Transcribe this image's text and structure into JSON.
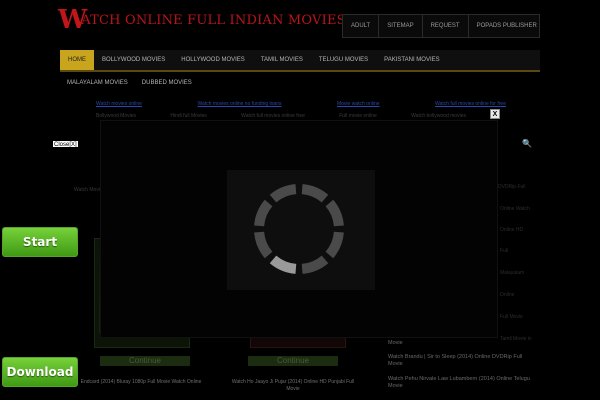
{
  "header": {
    "logo_letter": "W",
    "logo_text": "ATCH ONLINE FULL INDIAN MOVIES FREE",
    "top_links": [
      "ADULT",
      "SITEMAP",
      "REQUEST",
      "POPADS PUBLISHER"
    ]
  },
  "nav": {
    "items": [
      "HOME",
      "BOLLYWOOD MOVIES",
      "HOLLYWOOD MOVIES",
      "TAMIL MOVIES",
      "TELUGU MOVIES",
      "PAKISTANI MOVIES"
    ],
    "items2": [
      "MALAYALAM MOVIES",
      "DUBBED MOVIES"
    ]
  },
  "link_row": [
    "Watch movies online",
    "Watch movies online no funding loans",
    "Movie watch online",
    "Watch full movies online for free"
  ],
  "link_row2": [
    "Bollywood Movies",
    "Hindi full Movies",
    "Watch full movies online free",
    "Full movie online",
    "Watch bollywood movies"
  ],
  "background": {
    "heading": "Watch Movies Online",
    "side_items": [
      "DVDRip Full",
      "Online Watch",
      "Online HD",
      "Full",
      "Malayalam",
      "Online",
      "Full Movie",
      "Tamil Movie in"
    ],
    "side_bright": [
      "Movie",
      "Watch Brandu | Sir to Sleep (2014) Online DVDRip Full Movie",
      "Watch Pehu Nirvale Law Lubambern (2014) Online Telugu Movie"
    ],
    "continue_label": "Continue",
    "captions": [
      "Endcard (2014) Bluray 1080p Full Movie Watch Online",
      "Watch Ho Jaayo Ji Pujar (2014) Online HD Punjabi Full Movie"
    ]
  },
  "overlay": {
    "close_x": "X",
    "close_label": "Close[X]"
  },
  "buttons": {
    "start": "Start",
    "download": "Download"
  },
  "colors": {
    "accent_gold": "#c9a51d",
    "logo_red": "#b9151a",
    "button_green": "#5ab52a",
    "link_blue": "#2a47a8"
  }
}
